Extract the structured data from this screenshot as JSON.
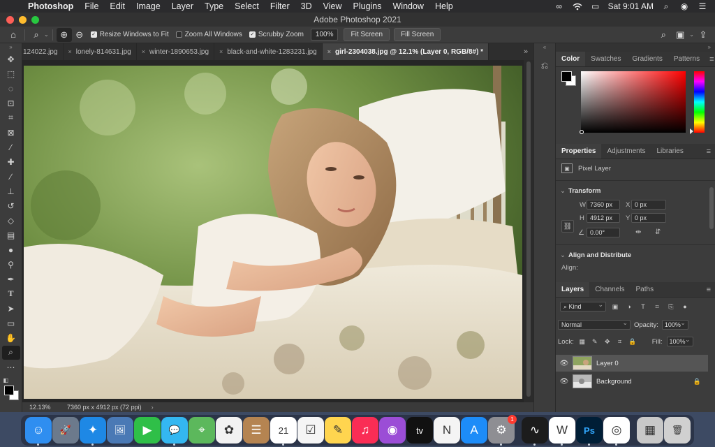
{
  "menubar": {
    "app_name": "Photoshop",
    "items": [
      "File",
      "Edit",
      "Image",
      "Layer",
      "Type",
      "Select",
      "Filter",
      "3D",
      "View",
      "Plugins",
      "Window",
      "Help"
    ],
    "clock": "Sat 9:01 AM",
    "status_icons": [
      "creative-cloud-icon",
      "wifi-icon",
      "airplay-icon",
      "spotlight-search-icon",
      "siri-icon",
      "control-center-icon"
    ]
  },
  "window": {
    "title": "Adobe Photoshop 2021"
  },
  "options_bar": {
    "resize_windows_label": "Resize Windows to Fit",
    "resize_windows_checked": true,
    "zoom_all_label": "Zoom All Windows",
    "zoom_all_checked": false,
    "scrubby_zoom_label": "Scrubby Zoom",
    "scrubby_zoom_checked": true,
    "zoom_value": "100%",
    "fit_screen_label": "Fit Screen",
    "fill_screen_label": "Fill Screen"
  },
  "tabs": [
    {
      "label": "124022.jpg",
      "active": false
    },
    {
      "label": "lonely-814631.jpg",
      "active": false
    },
    {
      "label": "winter-1890653.jpg",
      "active": false
    },
    {
      "label": "black-and-white-1283231.jpg",
      "active": false
    },
    {
      "label": "girl-2304038.jpg @ 12.1% (Layer 0, RGB/8#) *",
      "active": true
    }
  ],
  "tools": [
    "move-tool",
    "marquee-tool",
    "lasso-tool",
    "object-selection-tool",
    "crop-tool",
    "frame-tool",
    "eyedropper-tool",
    "healing-brush-tool",
    "brush-tool",
    "clone-stamp-tool",
    "history-brush-tool",
    "eraser-tool",
    "gradient-tool",
    "blur-tool",
    "dodge-tool",
    "pen-tool",
    "type-tool",
    "path-selection-tool",
    "rectangle-tool",
    "hand-tool",
    "zoom-tool",
    "edit-toolbar"
  ],
  "status": {
    "zoom": "12.13%",
    "doc_info": "7360 px x 4912 px (72 ppi)"
  },
  "color_panel": {
    "tabs": [
      "Color",
      "Swatches",
      "Gradients",
      "Patterns"
    ],
    "active_tab": "Color",
    "foreground": "#000000",
    "background": "#ffffff",
    "hue_color": "#ff0000"
  },
  "properties_panel": {
    "tabs": [
      "Properties",
      "Adjustments",
      "Libraries"
    ],
    "active_tab": "Properties",
    "layer_type": "Pixel Layer",
    "transform_title": "Transform",
    "w_label": "W",
    "w_value": "7360 px",
    "h_label": "H",
    "h_value": "4912 px",
    "x_label": "X",
    "x_value": "0 px",
    "y_label": "Y",
    "y_value": "0 px",
    "angle_value": "0.00°",
    "align_title": "Align and Distribute",
    "align_label": "Align:"
  },
  "layers_panel": {
    "tabs": [
      "Layers",
      "Channels",
      "Paths"
    ],
    "active_tab": "Layers",
    "kind_label": "Kind",
    "blend_mode": "Normal",
    "opacity_label": "Opacity:",
    "opacity_value": "100%",
    "lock_label": "Lock:",
    "fill_label": "Fill:",
    "fill_value": "100%",
    "layers": [
      {
        "name": "Layer 0",
        "visible": true,
        "selected": true,
        "locked": false
      },
      {
        "name": "Background",
        "visible": true,
        "selected": false,
        "locked": true
      }
    ]
  },
  "dock": {
    "apps": [
      {
        "name": "finder",
        "color": "#2f8ef0",
        "glyph": "☺"
      },
      {
        "name": "launchpad",
        "color": "#6c7a8c",
        "glyph": "🚀"
      },
      {
        "name": "safari",
        "color": "#1e88e5",
        "glyph": "✦"
      },
      {
        "name": "preview",
        "color": "#4a79b5",
        "glyph": "🖼"
      },
      {
        "name": "facetime",
        "color": "#2fbf48",
        "glyph": "▶"
      },
      {
        "name": "messages",
        "color": "#34b7f1",
        "glyph": "💬"
      },
      {
        "name": "maps",
        "color": "#5cb85c",
        "glyph": "⌖"
      },
      {
        "name": "photos",
        "color": "#f2f2f2",
        "glyph": "✿"
      },
      {
        "name": "contacts",
        "color": "#b58451",
        "glyph": "☰"
      },
      {
        "name": "calendar",
        "color": "#ffffff",
        "glyph": "21"
      },
      {
        "name": "reminders",
        "color": "#f5f5f5",
        "glyph": "☑"
      },
      {
        "name": "notes",
        "color": "#ffd54f",
        "glyph": "✎"
      },
      {
        "name": "music",
        "color": "#fa2d55",
        "glyph": "♫"
      },
      {
        "name": "podcasts",
        "color": "#9b4dd6",
        "glyph": "◉"
      },
      {
        "name": "apple-tv",
        "color": "#111111",
        "glyph": "tv"
      },
      {
        "name": "news",
        "color": "#f4f4f4",
        "glyph": "N"
      },
      {
        "name": "app-store",
        "color": "#1d8cf8",
        "glyph": "A"
      },
      {
        "name": "system-preferences",
        "color": "#8e8e93",
        "glyph": "⚙",
        "badge": "1"
      }
    ],
    "apps_right": [
      {
        "name": "activity-monitor",
        "color": "#1c1c1c",
        "glyph": "∿"
      },
      {
        "name": "webex",
        "color": "#ffffff",
        "glyph": "W"
      },
      {
        "name": "photoshop",
        "color": "#001e36",
        "glyph": "Ps"
      },
      {
        "name": "chrome",
        "color": "#ffffff",
        "glyph": "◎"
      }
    ],
    "stacks": [
      {
        "name": "downloads-stack",
        "color": "#c8c8c8",
        "glyph": "▦"
      },
      {
        "name": "trash",
        "color": "#d0d0d0",
        "glyph": "🗑"
      }
    ]
  }
}
